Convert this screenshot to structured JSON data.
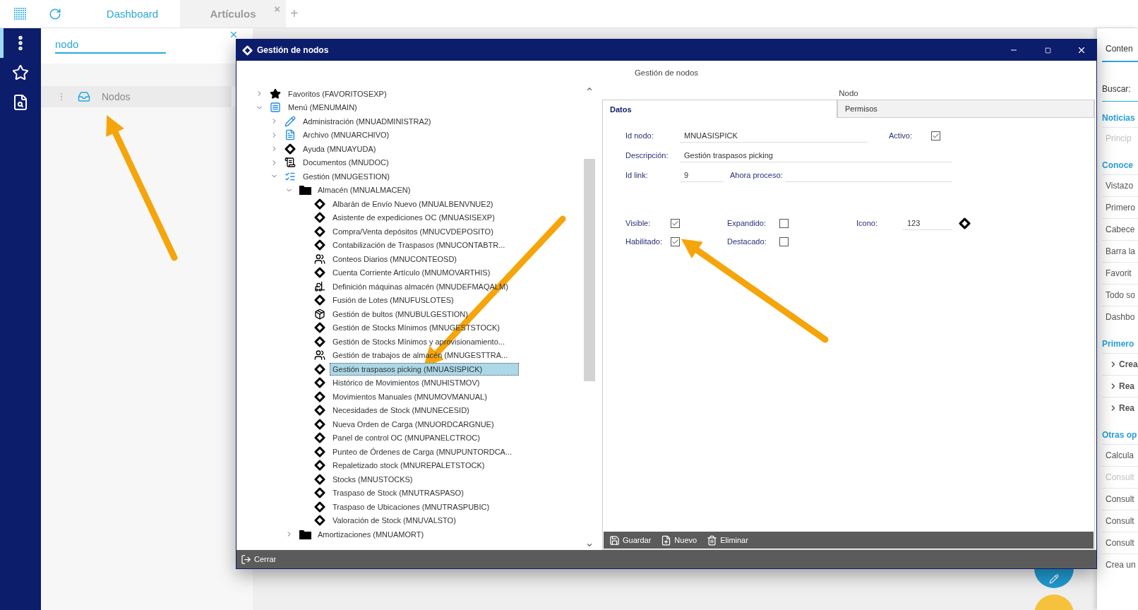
{
  "topbar": {
    "tabs": [
      {
        "label": "Dashboard",
        "selected": true
      },
      {
        "label": "Artículos",
        "selected": false,
        "close": "×"
      }
    ],
    "add": "+"
  },
  "search_panel": {
    "query": "nodo",
    "results": [
      {
        "label": "Nodos",
        "selected": true
      }
    ]
  },
  "dialog": {
    "title": "Gestión de nodos",
    "heading": "Gestión de nodos",
    "tree": [
      {
        "label": "Favoritos (FAVORITOSEXP)",
        "kind": "star",
        "expanded": false,
        "selected": false
      },
      {
        "label": "Menú (MENUMAIN)",
        "kind": "list",
        "expanded": true,
        "selected": false,
        "children": [
          {
            "label": "Administración (MNUADMINISTRA2)",
            "kind": "pencil",
            "expanded": false,
            "selected": false
          },
          {
            "label": "Archivo (MNUARCHIVO)",
            "kind": "doc",
            "expanded": false,
            "selected": false
          },
          {
            "label": "Ayuda (MNUAYUDA)",
            "kind": "diamond",
            "expanded": false,
            "selected": false
          },
          {
            "label": "Documentos (MNUDOC)",
            "kind": "document",
            "expanded": false,
            "selected": false
          },
          {
            "label": "Gestión (MNUGESTION)",
            "kind": "checklist",
            "expanded": true,
            "selected": false,
            "children": [
              {
                "label": "Almacén (MNUALMACEN)",
                "kind": "folder",
                "expanded": true,
                "selected": false,
                "children": [
                  {
                    "label": "Albarán de Envío Nuevo (MNUALBENVNUE2)",
                    "kind": "diamond",
                    "selected": false
                  },
                  {
                    "label": "Asistente de expediciones OC (MNUASISEXP)",
                    "kind": "diamond",
                    "selected": false
                  },
                  {
                    "label": "Compra/Venta depósitos (MNUCVDEPOSITO)",
                    "kind": "diamond",
                    "selected": false
                  },
                  {
                    "label": "Contabilización de Traspasos (MNUCONTABTR...",
                    "kind": "diamond",
                    "selected": false
                  },
                  {
                    "label": "Conteos Diarios (MNUCONTEOSD)",
                    "kind": "people",
                    "selected": false
                  },
                  {
                    "label": "Cuenta Corriente Artículo (MNUMOVARTHIS)",
                    "kind": "diamond",
                    "selected": false
                  },
                  {
                    "label": "Definición máquinas almacén (MNUDEFMAQALM)",
                    "kind": "machine",
                    "selected": false
                  },
                  {
                    "label": "Fusión de Lotes (MNUFUSLOTES)",
                    "kind": "diamond",
                    "selected": false
                  },
                  {
                    "label": "Gestión de bultos (MNUBULGESTION)",
                    "kind": "box",
                    "selected": false
                  },
                  {
                    "label": "Gestión de Stocks Mínimos (MNUGESTSTOCK)",
                    "kind": "diamond",
                    "selected": false
                  },
                  {
                    "label": "Gestión de Stocks Mínimos y aprovisionamiento...",
                    "kind": "diamond",
                    "selected": false
                  },
                  {
                    "label": "Gestión de trabajos de almacén (MNUGESTTRA...",
                    "kind": "people",
                    "selected": false
                  },
                  {
                    "label": "Gestión traspasos picking (MNUASISPICK)",
                    "kind": "diamond",
                    "selected": true
                  },
                  {
                    "label": "Histórico de Movimientos (MNUHISTMOV)",
                    "kind": "diamond",
                    "selected": false
                  },
                  {
                    "label": "Movimientos Manuales (MNUMOVMANUAL)",
                    "kind": "diamond",
                    "selected": false
                  },
                  {
                    "label": "Necesidades de Stock (MNUNECESID)",
                    "kind": "diamond",
                    "selected": false
                  },
                  {
                    "label": "Nueva Orden de Carga (MNUORDCARGNUE)",
                    "kind": "diamond",
                    "selected": false
                  },
                  {
                    "label": "Panel de control OC (MNUPANELCTROC)",
                    "kind": "diamond",
                    "selected": false
                  },
                  {
                    "label": "Punteo de Órdenes de Carga (MNUPUNTORDCA...",
                    "kind": "diamond",
                    "selected": false
                  },
                  {
                    "label": "Repaletizado stock (MNUREPALETSTOCK)",
                    "kind": "diamond",
                    "selected": false
                  },
                  {
                    "label": "Stocks (MNUSTOCKS)",
                    "kind": "diamond",
                    "selected": false
                  },
                  {
                    "label": "Traspaso de Stock (MNUTRASPASO)",
                    "kind": "diamond",
                    "selected": false
                  },
                  {
                    "label": "Traspaso de Ubicaciones (MNUTRASPUBIC)",
                    "kind": "diamond",
                    "selected": false
                  },
                  {
                    "label": "Valoración de Stock (MNUVALSTO)",
                    "kind": "diamond",
                    "selected": false
                  }
                ]
              },
              {
                "label": "Amortizaciones (MNUAMORT)",
                "kind": "folder",
                "expanded": false,
                "selected": false
              }
            ]
          }
        ]
      }
    ],
    "form": {
      "title": "Nodo",
      "tabs": [
        {
          "label": "Datos",
          "selected": true
        },
        {
          "label": "Permisos",
          "selected": false
        }
      ],
      "id_nodo": {
        "label": "Id nodo:",
        "value": "MNUASISPICK"
      },
      "activo": {
        "label": "Activo:",
        "checked": true
      },
      "descripcion": {
        "label": "Descripción:",
        "value": "Gestión traspasos picking"
      },
      "id_link": {
        "label": "Id link:",
        "value": "9"
      },
      "ahora_proceso": {
        "label": "Ahora proceso:"
      },
      "visible": {
        "label": "Visible:",
        "checked": true
      },
      "habilitado": {
        "label": "Habilitado:",
        "checked": true
      },
      "expandido": {
        "label": "Expandido:",
        "checked": false
      },
      "destacado": {
        "label": "Destacado:",
        "checked": false
      },
      "icono": {
        "label": "Icono:",
        "value": "123"
      }
    },
    "toolbar": [
      {
        "kind": "save",
        "label": "Guardar"
      },
      {
        "kind": "new",
        "label": "Nuevo"
      },
      {
        "kind": "delete",
        "label": "Eliminar"
      }
    ],
    "footer_button": "Cerrar"
  },
  "side_panel": {
    "tab": "Conten",
    "search_label": "Buscar:",
    "sections": [
      {
        "title": "Noticias",
        "items": [
          {
            "label": "Princip",
            "kind": "plain",
            "disabled": true
          }
        ]
      },
      {
        "title": "Conoce",
        "items": [
          {
            "label": "Vistazo",
            "kind": "plain",
            "disabled": false
          },
          {
            "label": "Primero",
            "kind": "plain",
            "disabled": false
          },
          {
            "label": "Cabece",
            "kind": "plain",
            "disabled": false
          },
          {
            "label": "Barra la",
            "kind": "plain",
            "disabled": false
          },
          {
            "label": "Favorit",
            "kind": "plain",
            "disabled": false
          },
          {
            "label": "Todo so",
            "kind": "plain",
            "disabled": false
          },
          {
            "label": "Dashbo",
            "kind": "plain",
            "disabled": false
          }
        ]
      },
      {
        "title": "Primero",
        "items": [
          {
            "label": "Crea",
            "kind": "chevron",
            "disabled": false
          },
          {
            "label": "Rea",
            "kind": "chevron",
            "disabled": false
          },
          {
            "label": "Rea",
            "kind": "chevron",
            "disabled": false
          }
        ]
      },
      {
        "title": "Otras op",
        "items": [
          {
            "label": "Calcula",
            "kind": "plain",
            "disabled": false
          },
          {
            "label": "Consult",
            "kind": "plain",
            "disabled": true
          },
          {
            "label": "Consult",
            "kind": "plain",
            "disabled": false
          },
          {
            "label": "Consult",
            "kind": "plain",
            "disabled": false
          },
          {
            "label": "Consult",
            "kind": "plain",
            "disabled": false
          },
          {
            "label": "Crea un",
            "kind": "plain",
            "disabled": false
          }
        ]
      }
    ]
  }
}
